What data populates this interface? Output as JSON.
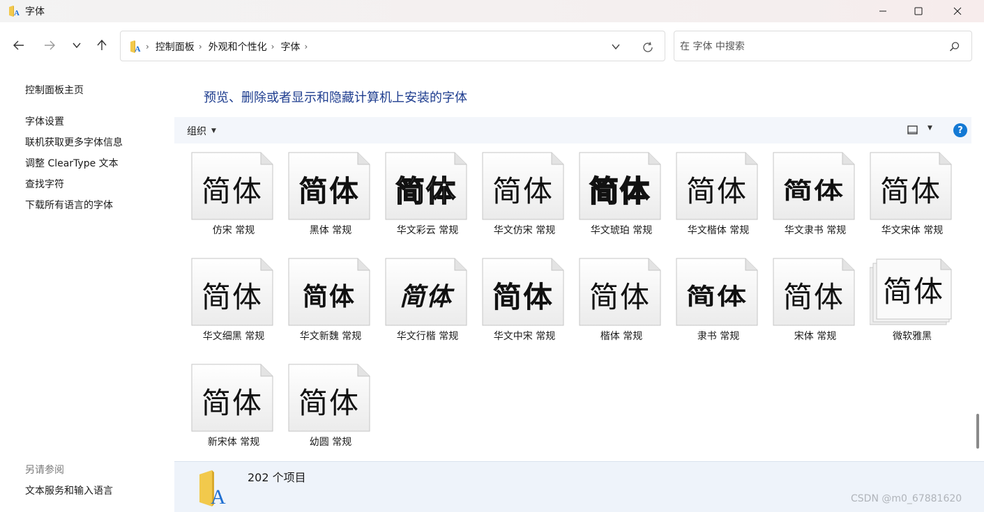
{
  "window": {
    "title": "字体",
    "min_glyph": "—",
    "max_glyph": "☐",
    "close_glyph": "✕"
  },
  "address": {
    "crumbs": [
      "控制面板",
      "外观和个性化",
      "字体"
    ],
    "separator": "›"
  },
  "search": {
    "placeholder": "在 字体 中搜索"
  },
  "sidebar": {
    "home": "控制面板主页",
    "links": [
      "字体设置",
      "联机获取更多字体信息",
      "调整 ClearType 文本",
      "查找字符",
      "下载所有语言的字体"
    ],
    "see_also_header": "另请参阅",
    "see_also_links": [
      "文本服务和输入语言"
    ]
  },
  "main": {
    "heading": "预览、删除或者显示和隐藏计算机上安装的字体",
    "toolbar": {
      "organize": "组织",
      "caret": "▼",
      "help": "?"
    }
  },
  "fonts": [
    {
      "label": "仿宋 常规",
      "preview": "简体",
      "style": "fangsong"
    },
    {
      "label": "黑体 常规",
      "preview": "简体",
      "style": "hei"
    },
    {
      "label": "华文彩云 常规",
      "preview": "简体",
      "style": "caiyun"
    },
    {
      "label": "华文仿宋 常规",
      "preview": "简体",
      "style": "fangsong"
    },
    {
      "label": "华文琥珀 常规",
      "preview": "简体",
      "style": "hupo"
    },
    {
      "label": "华文楷体 常规",
      "preview": "简体",
      "style": "kai"
    },
    {
      "label": "华文隶书 常规",
      "preview": "简体",
      "style": "li"
    },
    {
      "label": "华文宋体 常规",
      "preview": "简体",
      "style": "song"
    },
    {
      "label": "华文细黑 常规",
      "preview": "简体",
      "style": "xihei"
    },
    {
      "label": "华文新魏 常规",
      "preview": "简体",
      "style": "xinwei"
    },
    {
      "label": "华文行楷 常规",
      "preview": "简体",
      "style": "xingkai"
    },
    {
      "label": "华文中宋 常规",
      "preview": "简体",
      "style": "zhongsong"
    },
    {
      "label": "楷体 常规",
      "preview": "简体",
      "style": "kai"
    },
    {
      "label": "隶书 常规",
      "preview": "简体",
      "style": "li"
    },
    {
      "label": "宋体 常规",
      "preview": "简体",
      "style": "song"
    },
    {
      "label": "微软雅黑",
      "preview": "简体",
      "style": "yahei",
      "family": true
    },
    {
      "label": "新宋体 常规",
      "preview": "简体",
      "style": "song"
    },
    {
      "label": "幼圆 常规",
      "preview": "简体",
      "style": "youyuan"
    }
  ],
  "status": {
    "count": "202 个项目"
  },
  "watermark": "CSDN @m0_67881620",
  "colors": {
    "heading": "#1e3d8f",
    "help_button": "#1479d4",
    "toolbar_bg": "#f3f6fb",
    "status_bg": "#eef3fa",
    "folder_yellow": "#f2c94c",
    "font_letter_blue": "#1f6fd1"
  }
}
